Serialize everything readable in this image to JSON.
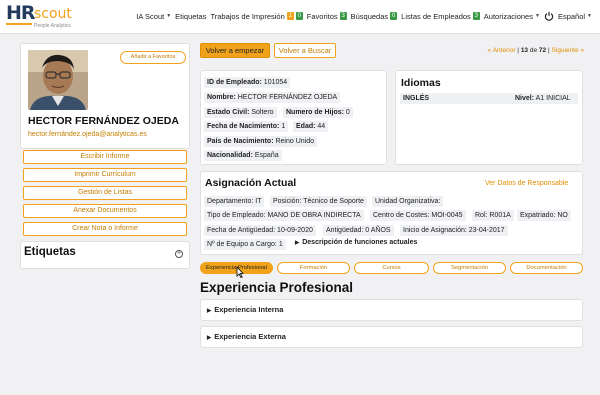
{
  "brand": {
    "hr": "HR",
    "scout": "scout",
    "tagline": "People Analytics"
  },
  "nav": {
    "ia_scout": "IA Scout",
    "etiquetas": "Etiquetas",
    "trabajos": "Trabajos de Impresión",
    "trabajos_badge1": "1",
    "trabajos_badge2": "0",
    "favoritos": "Favoritos",
    "favoritos_badge": "3",
    "busquedas": "Búsquedas",
    "busquedas_badge": "0",
    "listas": "Listas de Empleados",
    "listas_badge": "3",
    "autorizaciones": "Autorizaciones",
    "idioma": "Español"
  },
  "profile": {
    "fav_button": "Añadir a Favoritos",
    "name": "HECTOR FERNÁNDEZ OJEDA",
    "email": "hector.fernández.ojeda@analyticas.es",
    "actions": [
      "Escribir Informe",
      "Imprimir Currículum",
      "Gestión de Listas",
      "Anexar Documentos",
      "Crear Nota o Informe"
    ],
    "etiquetas_title": "Etiquetas"
  },
  "toolbar": {
    "volver_empezar": "Volver a empezar",
    "volver_buscar": "Volver a Buscar",
    "anterior": "« Anterior",
    "separator": "|",
    "current": "13",
    "de": "de",
    "total": "72",
    "siguiente": "Siguiente »"
  },
  "employee": {
    "id_label": "ID de Empleado:",
    "id_value": "101054",
    "nombre_label": "Nombre:",
    "nombre_value": "HECTOR FERNÁNDEZ OJEDA",
    "estado_label": "Estado Civil:",
    "estado_value": "Soltero",
    "hijos_label": "Numero de Hijos:",
    "hijos_value": "0",
    "fnac_label": "Fecha de Nacimiento:",
    "fnac_value": "1",
    "edad_label": "Edad:",
    "edad_value": "44",
    "pais_label": "País de Nacimiento:",
    "pais_value": "Reino Unido",
    "nac_label": "Nacionalidad:",
    "nac_value": "España"
  },
  "idiomas": {
    "title": "Idiomas",
    "lang": "INGLÉS",
    "nivel_label": "Nivel:",
    "nivel_value": "A1 INICIAL"
  },
  "asignacion": {
    "title": "Asignación Actual",
    "ver_responsable": "Ver Datos de Responsable",
    "departamento": "Departamento: IT",
    "posicion": "Posición: Técnico de Soporte",
    "unidad": "Unidad Organizativa:",
    "tipo": "Tipo de Empleado: MANO DE OBRA INDIRECTA",
    "centro": "Centro de Costes: MOI-0045",
    "rol": "Rol: R001A",
    "expatriado": "Expatriado: NO",
    "antiguedad_fecha": "Fecha de Antigüedad: 10-09-2020",
    "antiguedad": "Antigüedad: 0 AÑOS",
    "inicio": "Inicio de Asignación: 23-04-2017",
    "equipo": "Nº de Equipo a Cargo: 1",
    "descripcion": "Descripción de funciones actuales"
  },
  "tabs": [
    "Experiencia Profesional",
    "Formación",
    "Cursos",
    "Segmentación",
    "Documentación"
  ],
  "experiencia": {
    "title": "Experiencia Profesional",
    "interna": "Experiencia Interna",
    "externa": "Experiencia Externa"
  },
  "colors": {
    "accent": "#f0a21b",
    "navy": "#233b5d",
    "badge_green": "#3a9a47"
  }
}
